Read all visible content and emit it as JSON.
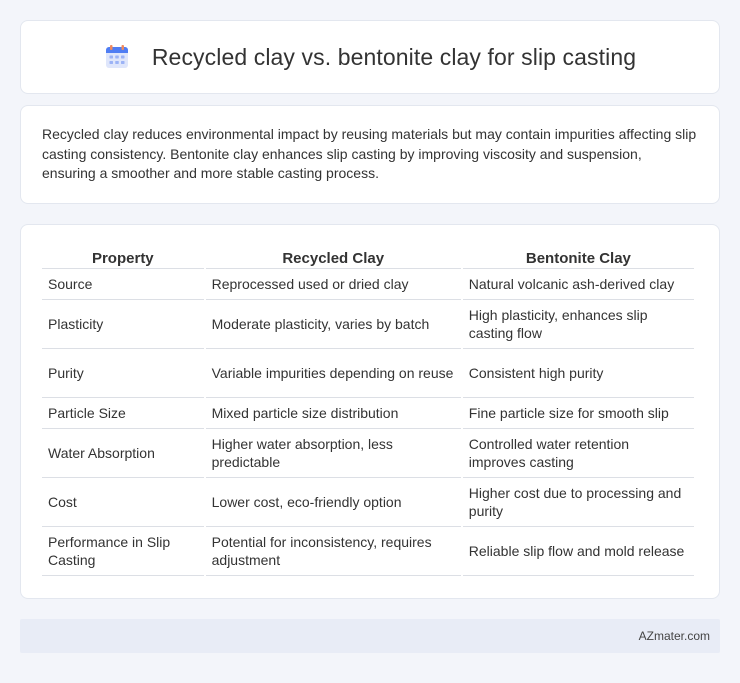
{
  "header": {
    "title": "Recycled clay vs. bentonite clay for slip casting",
    "icon": "calendar-icon"
  },
  "description": "Recycled clay reduces environmental impact by reusing materials but may contain impurities affecting slip casting consistency. Bentonite clay enhances slip casting by improving viscosity and suspension, ensuring a smoother and more stable casting process.",
  "table": {
    "columns": [
      "Property",
      "Recycled Clay",
      "Bentonite Clay"
    ],
    "rows": [
      [
        "Source",
        "Reprocessed used or dried clay",
        "Natural volcanic ash-derived clay"
      ],
      [
        "Plasticity",
        "Moderate plasticity, varies by batch",
        "High plasticity, enhances slip casting flow"
      ],
      [
        "Purity",
        "Variable impurities depending on reuse",
        "Consistent high purity"
      ],
      [
        "Particle Size",
        "Mixed particle size distribution",
        "Fine particle size for smooth slip"
      ],
      [
        "Water Absorption",
        "Higher water absorption, less predictable",
        "Controlled water retention improves casting"
      ],
      [
        "Cost",
        "Lower cost, eco-friendly option",
        "Higher cost due to processing and purity"
      ],
      [
        "Performance in Slip Casting",
        "Potential for inconsistency, requires adjustment",
        "Reliable slip flow and mold release"
      ]
    ]
  },
  "footer": {
    "brand": "AZmater.com"
  }
}
